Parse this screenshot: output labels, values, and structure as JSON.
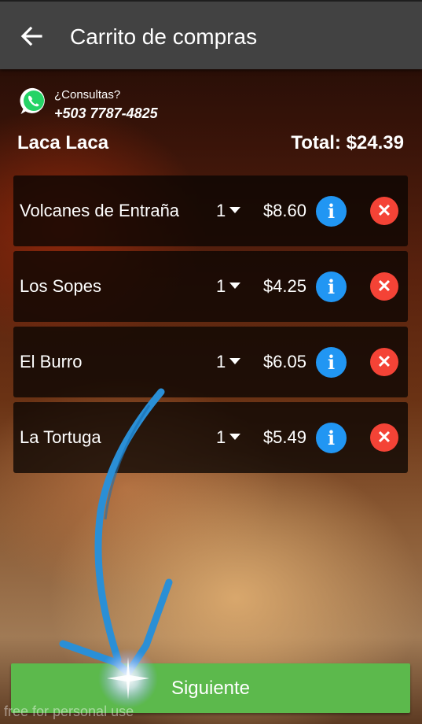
{
  "header": {
    "back_icon": "arrow-left-icon",
    "title": "Carrito de compras"
  },
  "contact": {
    "icon": "whatsapp-icon",
    "label": "¿Consultas?",
    "phone": "+503 7787-4825"
  },
  "cart": {
    "store": "Laca Laca",
    "total": "Total: $24.39",
    "items": [
      {
        "name": "Volcanes de Entraña",
        "qty": "1",
        "price": "$8.60"
      },
      {
        "name": "Los Sopes",
        "qty": "1",
        "price": "$4.25"
      },
      {
        "name": "El Burro",
        "qty": "1",
        "price": "$6.05"
      },
      {
        "name": "La Tortuga",
        "qty": "1",
        "price": "$5.49"
      }
    ]
  },
  "footer": {
    "next_label": "Siguiente"
  },
  "overlay": {
    "watermark": "free for personal use"
  },
  "colors": {
    "topbar": "#424242",
    "info": "#2196f3",
    "delete": "#f44336",
    "next": "#5cb94c"
  }
}
